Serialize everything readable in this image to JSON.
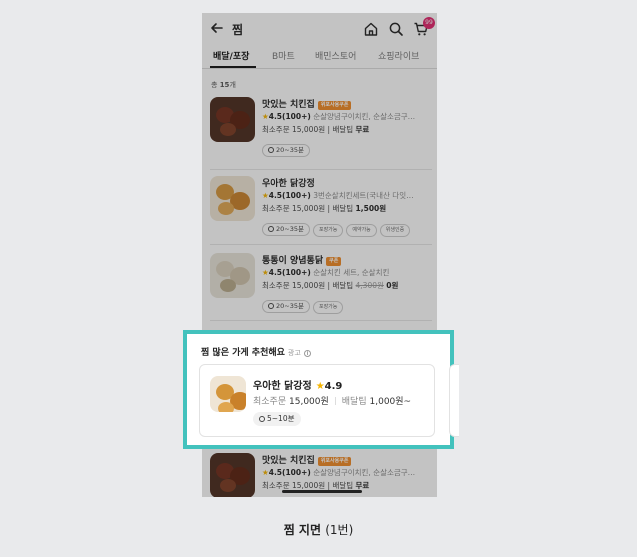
{
  "header": {
    "title": "찜",
    "cart_badge": "99"
  },
  "tabs": [
    {
      "label": "배달/포장"
    },
    {
      "label": "B마트"
    },
    {
      "label": "배민스토어"
    },
    {
      "label": "쇼핑라이브"
    }
  ],
  "list": {
    "count_prefix": "총",
    "count_value": "15",
    "count_suffix": "개",
    "stores": [
      {
        "name": "맛있는 치킨집",
        "tag": "위포사용쿠폰",
        "rating": "4.5",
        "reviews": "(100+)",
        "menu": "순살양념구이치킨, 순살소금구…",
        "min_order": "최소주문 15,000원",
        "tip_label": "배달팁",
        "tip": "무료",
        "tip_strike": "",
        "time": "20~35분",
        "extra_chips": []
      },
      {
        "name": "우아한 닭강정",
        "tag": "",
        "rating": "4.5",
        "reviews": "(100+)",
        "menu": "3번순살치킨세트(국내산 다잇…",
        "min_order": "최소주문 15,000원",
        "tip_label": "배달팁",
        "tip": "1,500원",
        "tip_strike": "",
        "time": "20~35분",
        "extra_chips": [
          "포장가능",
          "예약가능",
          "위생인증"
        ]
      },
      {
        "name": "통통이 양념통닭",
        "tag": "쿠폰",
        "rating": "4.5",
        "reviews": "(100+)",
        "menu": "순살치킨 세트, 순살치킨",
        "min_order": "최소주문 15,000원",
        "tip_label": "배달팁",
        "tip": "0원",
        "tip_strike": "4,300원",
        "time": "20~35분",
        "extra_chips": [
          "포장가능"
        ]
      },
      {
        "name": "맛있는 치킨집",
        "tag": "위포사용쿠폰",
        "rating": "4.5",
        "reviews": "(100+)",
        "menu": "순살양념구이치킨, 순살소금구…",
        "min_order": "최소주문 15,000원",
        "tip_label": "배달팁",
        "tip": "무료",
        "tip_strike": "",
        "time": "",
        "extra_chips": []
      }
    ]
  },
  "recommend": {
    "title": "찜 많은 가게 추천해요",
    "ad_label": "광고",
    "card": {
      "name": "우아한 닭강정",
      "rating": "4.9",
      "min_order_label": "최소주문",
      "min_order": "15,000원",
      "tip_label": "배달팁",
      "tip": "1,000원~",
      "time": "5~10분"
    }
  },
  "caption": {
    "main": "찜 지면",
    "sub": "(1번)"
  },
  "colors": {
    "highlight": "#43c2bd",
    "tag": "#f08a24",
    "star": "#f5b400",
    "badge": "#e2246d"
  },
  "icons": [
    "back-arrow-icon",
    "home-icon",
    "search-icon",
    "cart-icon",
    "star-icon",
    "clock-icon",
    "info-icon"
  ]
}
